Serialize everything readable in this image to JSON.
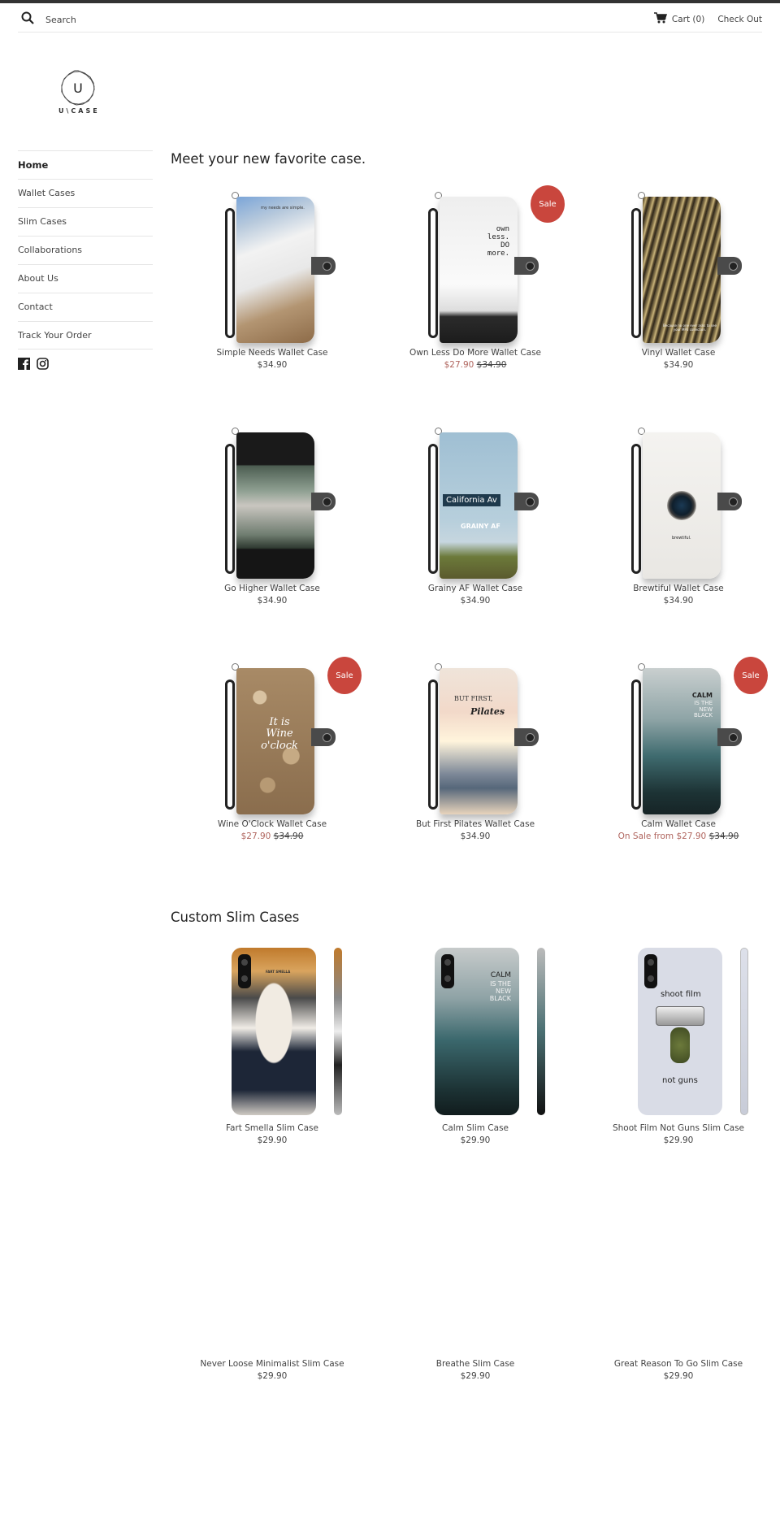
{
  "header": {
    "search_placeholder": "Search",
    "cart_label": "Cart (0)",
    "checkout_label": "Check Out"
  },
  "logo": {
    "letter": "U",
    "text": "U\\CASE"
  },
  "sidebar": {
    "items": [
      {
        "label": "Home",
        "active": true
      },
      {
        "label": "Wallet Cases"
      },
      {
        "label": "Slim Cases"
      },
      {
        "label": "Collaborations"
      },
      {
        "label": "About Us"
      },
      {
        "label": "Contact"
      },
      {
        "label": "Track Your Order"
      }
    ],
    "social": [
      "facebook-icon",
      "instagram-icon"
    ]
  },
  "sections": [
    {
      "title": "Meet your new favorite case.",
      "products": [
        {
          "title": "Simple Needs Wallet Case",
          "price": "$34.90",
          "sale": false,
          "image_text": "my needs are simple."
        },
        {
          "title": "Own Less Do More Wallet Case",
          "sale_price": "$27.90",
          "orig_price": "$34.90",
          "sale": true,
          "badge": "Sale",
          "image_text": "own less. DO more."
        },
        {
          "title": "Vinyl Wallet Case",
          "price": "$34.90",
          "sale": false,
          "image_text": "Because no one ever asks to see your MP3 collection."
        },
        {
          "title": "Go Higher Wallet Case",
          "price": "$34.90",
          "sale": false,
          "image_text": ""
        },
        {
          "title": "Grainy AF Wallet Case",
          "price": "$34.90",
          "sale": false,
          "image_text": "California Av",
          "image_text2": "GRAINY AF"
        },
        {
          "title": "Brewtiful Wallet Case",
          "price": "$34.90",
          "sale": false,
          "image_text": "brewtiful."
        },
        {
          "title": "Wine O'Clock Wallet Case",
          "sale_price": "$27.90",
          "orig_price": "$34.90",
          "sale": true,
          "badge": "Sale",
          "image_text": "It is Wine o'clock"
        },
        {
          "title": "But First Pilates Wallet Case",
          "price": "$34.90",
          "sale": false,
          "image_text": "BUT FIRST,",
          "image_text2": "Pilates"
        },
        {
          "title": "Calm Wallet Case",
          "sale_price": "On Sale from $27.90",
          "orig_price": "$34.90",
          "sale": true,
          "badge": "Sale",
          "image_text": "CALM",
          "image_text2": "IS THE NEW BLACK"
        }
      ]
    },
    {
      "title": "Custom Slim Cases",
      "products": [
        {
          "title": "Fart Smella Slim Case",
          "price": "$29.90",
          "image_text": "FART SMELLA"
        },
        {
          "title": "Calm Slim Case",
          "price": "$29.90",
          "image_text": "CALM",
          "image_text2": "IS THE NEW BLACK"
        },
        {
          "title": "Shoot Film Not Guns Slim Case",
          "price": "$29.90",
          "image_text": "shoot film",
          "image_text2": "not guns"
        },
        {
          "title": "Never Loose Minimalist Slim Case",
          "price": "$29.90"
        },
        {
          "title": "Breathe Slim Case",
          "price": "$29.90"
        },
        {
          "title": "Great Reason To Go Slim Case",
          "price": "$29.90"
        }
      ]
    }
  ],
  "colors": {
    "sale_badge": "#c9463d",
    "sale_price": "#b0655e",
    "topbar": "#333333"
  }
}
